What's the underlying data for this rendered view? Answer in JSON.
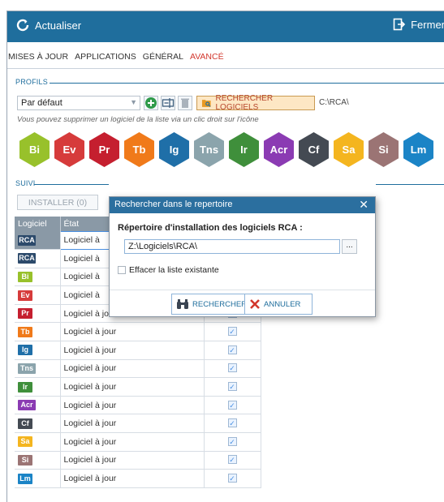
{
  "toolbar": {
    "refresh_label": "Actualiser",
    "close_label": "Fermer"
  },
  "tabs": [
    {
      "label": "MISES À JOUR",
      "active": false
    },
    {
      "label": "APPLICATIONS",
      "active": false
    },
    {
      "label": "GÉNÉRAL",
      "active": false
    },
    {
      "label": "AVANCÉ",
      "active": true
    }
  ],
  "profils": {
    "section_title": "PROFILS",
    "profile_select": "Par défaut",
    "search_button": "RECHERCHER LOGICIELS",
    "current_path": "C:\\RCA\\",
    "hint": "Vous pouvez supprimer un logiciel de la liste via un clic droit sur l'icône"
  },
  "apps": [
    {
      "code": "Bi",
      "color": "#98c12b"
    },
    {
      "code": "Ev",
      "color": "#d63b3b"
    },
    {
      "code": "Pr",
      "color": "#c51f2f"
    },
    {
      "code": "Tb",
      "color": "#f07a1a"
    },
    {
      "code": "Ig",
      "color": "#1f6fa8"
    },
    {
      "code": "Tns",
      "color": "#8ba4ac"
    },
    {
      "code": "Ir",
      "color": "#3f8f3b"
    },
    {
      "code": "Acr",
      "color": "#8b3bb3"
    },
    {
      "code": "Cf",
      "color": "#444a53"
    },
    {
      "code": "Sa",
      "color": "#f4b51f"
    },
    {
      "code": "Si",
      "color": "#9b7474"
    },
    {
      "code": "Lm",
      "color": "#1b84c6"
    }
  ],
  "suivi": {
    "section_title": "SUIVI",
    "install_button": "INSTALLER (0)",
    "columns": {
      "logiciel": "Logiciel",
      "etat": "État"
    },
    "rows": [
      {
        "code": "RCA",
        "color": "#2c4a6b",
        "state": "Logiciel à",
        "checked": false,
        "selected": true
      },
      {
        "code": "RCA",
        "color": "#2c4a6b",
        "state": "Logiciel à",
        "checked": false,
        "selected": false
      },
      {
        "code": "Bi",
        "color": "#98c12b",
        "state": "Logiciel à",
        "checked": false,
        "selected": false
      },
      {
        "code": "Ev",
        "color": "#d63b3b",
        "state": "Logiciel à",
        "checked": false,
        "selected": false
      },
      {
        "code": "Pr",
        "color": "#c51f2f",
        "state": "Logiciel à jour",
        "checked": true,
        "selected": false
      },
      {
        "code": "Tb",
        "color": "#f07a1a",
        "state": "Logiciel à jour",
        "checked": true,
        "selected": false
      },
      {
        "code": "Ig",
        "color": "#1f6fa8",
        "state": "Logiciel à jour",
        "checked": true,
        "selected": false
      },
      {
        "code": "Tns",
        "color": "#8ba4ac",
        "state": "Logiciel à jour",
        "checked": true,
        "selected": false
      },
      {
        "code": "Ir",
        "color": "#3f8f3b",
        "state": "Logiciel à jour",
        "checked": true,
        "selected": false
      },
      {
        "code": "Acr",
        "color": "#8b3bb3",
        "state": "Logiciel à jour",
        "checked": true,
        "selected": false
      },
      {
        "code": "Cf",
        "color": "#444a53",
        "state": "Logiciel à jour",
        "checked": true,
        "selected": false
      },
      {
        "code": "Sa",
        "color": "#f4b51f",
        "state": "Logiciel à jour",
        "checked": true,
        "selected": false
      },
      {
        "code": "Si",
        "color": "#9b7474",
        "state": "Logiciel à jour",
        "checked": true,
        "selected": false
      },
      {
        "code": "Lm",
        "color": "#1b84c6",
        "state": "Logiciel à jour",
        "checked": true,
        "selected": false
      }
    ]
  },
  "dialog": {
    "title": "Rechercher dans le repertoire",
    "label": "Répertoire d'installation des logiciels RCA :",
    "path_value": "Z:\\Logiciels\\RCA\\",
    "browse_label": "...",
    "checkbox_label": "Effacer la liste existante",
    "search_button": "RECHERCHER",
    "cancel_button": "ANNULER"
  }
}
